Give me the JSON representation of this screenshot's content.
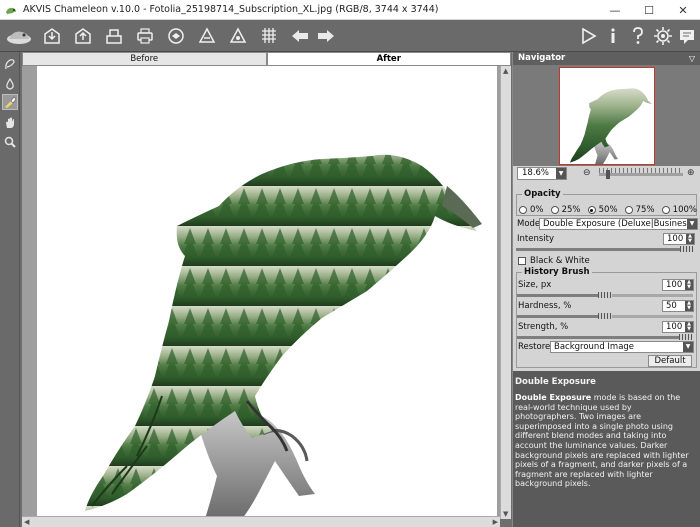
{
  "window": {
    "title": "AKVIS Chameleon v.10.0 - Fotolia_25198714_Subscription_XL.jpg (RGB/8, 3744 x 3744)",
    "minimize_glyph": "—",
    "maximize_glyph": "☐",
    "close_glyph": "✕"
  },
  "toolbar": {
    "icons": [
      "akvis-logo-icon",
      "open-icon",
      "save-icon",
      "batch-icon",
      "print-icon",
      "share-icon",
      "plugin-icon",
      "brush-icon",
      "grid-icon",
      "undo-arrow-icon",
      "redo-arrow-icon",
      "run-icon",
      "info-icon",
      "help-icon",
      "settings-icon",
      "chat-icon"
    ]
  },
  "left_tools": [
    "selection-brush-icon",
    "drop-icon",
    "history-brush-icon",
    "hand-icon",
    "zoom-icon"
  ],
  "tabs": {
    "before": "Before",
    "after": "After"
  },
  "navigator": {
    "title": "Navigator",
    "chevron": "▽",
    "zoom_value": "18.6%",
    "zoom_minus": "⊖",
    "zoom_plus": "⊕",
    "zoom_level": 0.08
  },
  "opacity": {
    "title": "Opacity",
    "options": [
      "0%",
      "25%",
      "50%",
      "75%",
      "100%"
    ],
    "selected": "50%"
  },
  "mode": {
    "label": "Mode",
    "value": "Double Exposure (Deluxe|Business)"
  },
  "intensity": {
    "label": "Intensity",
    "value": "100",
    "level": 1.0
  },
  "black_white": {
    "label": "Black & White",
    "checked": false
  },
  "history_brush": {
    "title": "History Brush",
    "size": {
      "label": "Size, px",
      "value": "100",
      "level": 0.5
    },
    "hardness": {
      "label": "Hardness, %",
      "value": "50",
      "level": 0.5
    },
    "strength": {
      "label": "Strength, %",
      "value": "100",
      "level": 1.0
    },
    "restore": {
      "label": "Restore",
      "value": "Background Image"
    },
    "default_label": "Default"
  },
  "help": {
    "title": "Double Exposure",
    "bold": "Double Exposure",
    "text": " mode is based on the real-world technique used by photographers. Two images are superimposed into a single photo using different blend modes and taking into account the luminance values. Darker background pixels are replaced with lighter pixels of a fragment, and darker pixels of a fragment are replaced with lighter background pixels."
  },
  "colors": {
    "toolbar": "#6a6a6a",
    "panel": "#d4d4d4",
    "help_bg": "#5a5a5a",
    "canvas_bg": "#ffffff"
  }
}
